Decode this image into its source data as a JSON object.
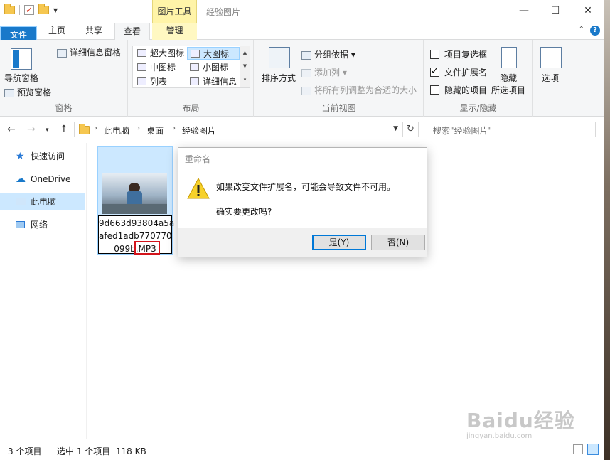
{
  "window": {
    "title": "经验图片",
    "context_tab": "图片工具",
    "controls": {
      "minimize": "—",
      "maximize": "☐",
      "close": "✕"
    }
  },
  "ribbon_tabs": {
    "file": "文件",
    "home": "主页",
    "share": "共享",
    "view": "查看",
    "manage": "管理",
    "active": "查看"
  },
  "ribbon": {
    "panes": {
      "nav_pane": "导航窗格",
      "preview_pane": "预览窗格",
      "details_pane": "详细信息窗格",
      "label": "窗格"
    },
    "layout": {
      "items": [
        "超大图标",
        "大图标",
        "中图标",
        "小图标",
        "列表",
        "详细信息"
      ],
      "selected": "大图标",
      "label": "布局"
    },
    "current_view": {
      "sort_by": "排序方式",
      "group_by": "分组依据",
      "add_columns": "添加列",
      "size_columns": "将所有列调整为合适的大小",
      "label": "当前视图"
    },
    "show_hide": {
      "item_checkboxes": {
        "label": "项目复选框",
        "checked": false
      },
      "file_extensions": {
        "label": "文件扩展名",
        "checked": true
      },
      "hidden_items": {
        "label": "隐藏的项目",
        "checked": false
      },
      "hide_selected_top": "隐藏",
      "hide_selected_bottom": "所选项目",
      "label": "显示/隐藏"
    },
    "options": "选项"
  },
  "address": {
    "crumbs": [
      "此电脑",
      "桌面",
      "经验图片"
    ],
    "search_placeholder": "搜索\"经验图片\""
  },
  "nav_pane": {
    "items": [
      "快速访问",
      "OneDrive",
      "此电脑",
      "网络"
    ],
    "selected": "此电脑"
  },
  "file_item": {
    "rename_line1": "9d663d93804a5a",
    "rename_line2": "afed1adb770770",
    "rename_line3": "099b.MP3"
  },
  "dialog": {
    "title": "重命名",
    "message": "如果改变文件扩展名，可能会导致文件不可用。",
    "question": "确实要更改吗?",
    "yes": "是(Y)",
    "no": "否(N)"
  },
  "status": {
    "count": "3 个项目",
    "selection": "选中 1 个项目  118 KB"
  },
  "watermark": {
    "brand": "Baidu经验",
    "url": "jingyan.baidu.com"
  }
}
